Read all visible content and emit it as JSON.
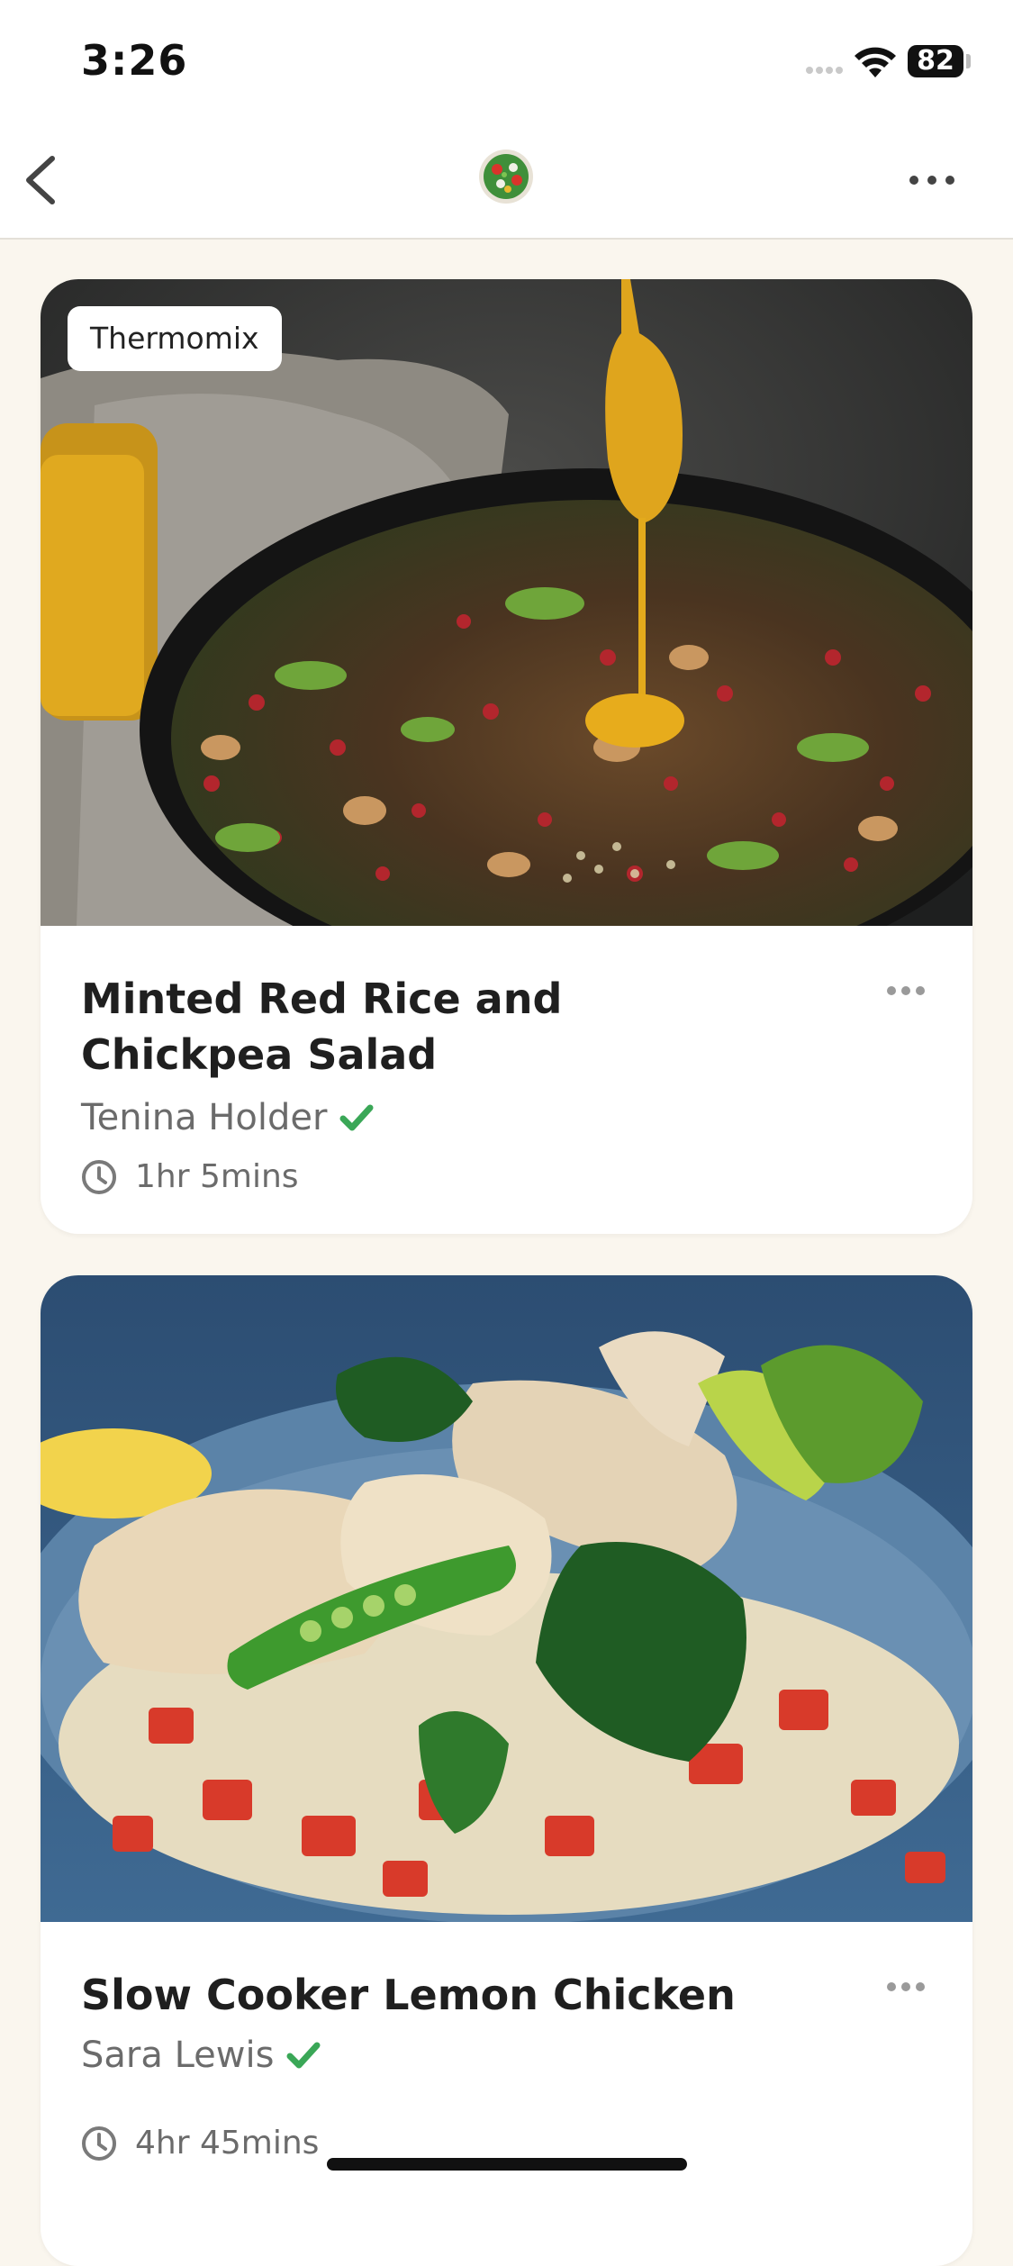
{
  "status_bar": {
    "time": "3:26",
    "battery": "82"
  },
  "nav": {
    "back_icon": "chevron-left-icon",
    "logo_icon": "salad-logo-icon",
    "more_icon": "ellipsis-icon"
  },
  "colors": {
    "background": "#faf6ee",
    "verified": "#3aa757",
    "text_muted": "#6b6b6b"
  },
  "recipes": [
    {
      "badge": "Thermomix",
      "title_line1": "Minted Red Rice and",
      "title_line2": "Chickpea Salad",
      "author": "Tenina Holder",
      "verified": true,
      "duration": "1hr 5mins"
    },
    {
      "title_line1": "Slow Cooker Lemon Chicken",
      "author": "Sara Lewis",
      "verified": true,
      "duration": "4hr 45mins"
    }
  ]
}
